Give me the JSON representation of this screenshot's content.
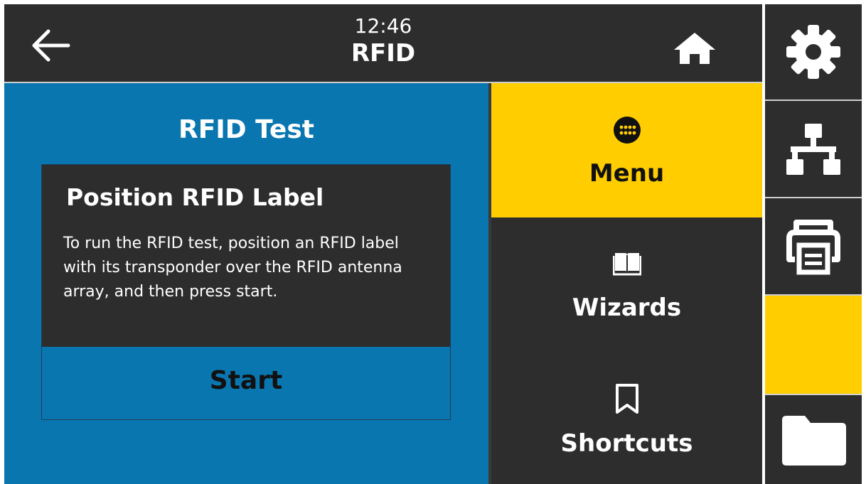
{
  "header": {
    "time": "12:46",
    "title": "RFID"
  },
  "test_panel": {
    "title": "RFID Test",
    "dialog": {
      "title": "Position RFID Label",
      "body": "To run the RFID test, position an RFID label with its transponder over the RFID antenna array, and then press start.",
      "start_label": "Start"
    }
  },
  "tiles": [
    {
      "label": "Menu",
      "icon": "menu-dots-icon",
      "selected": true
    },
    {
      "label": "Wizards",
      "icon": "book-icon",
      "selected": false
    },
    {
      "label": "Shortcuts",
      "icon": "bookmark-icon",
      "selected": false
    }
  ],
  "sidebar": {
    "items": [
      {
        "icon": "gear-icon"
      },
      {
        "icon": "network-icon"
      },
      {
        "icon": "printer-icon"
      },
      {
        "icon": "",
        "active": true
      },
      {
        "icon": "folder-icon"
      }
    ]
  },
  "colors": {
    "background": "#2d2d2d",
    "panel_blue": "#0a76b0",
    "accent_yellow": "#ffcd00",
    "text_light": "#ffffff",
    "text_dark": "#111111"
  }
}
